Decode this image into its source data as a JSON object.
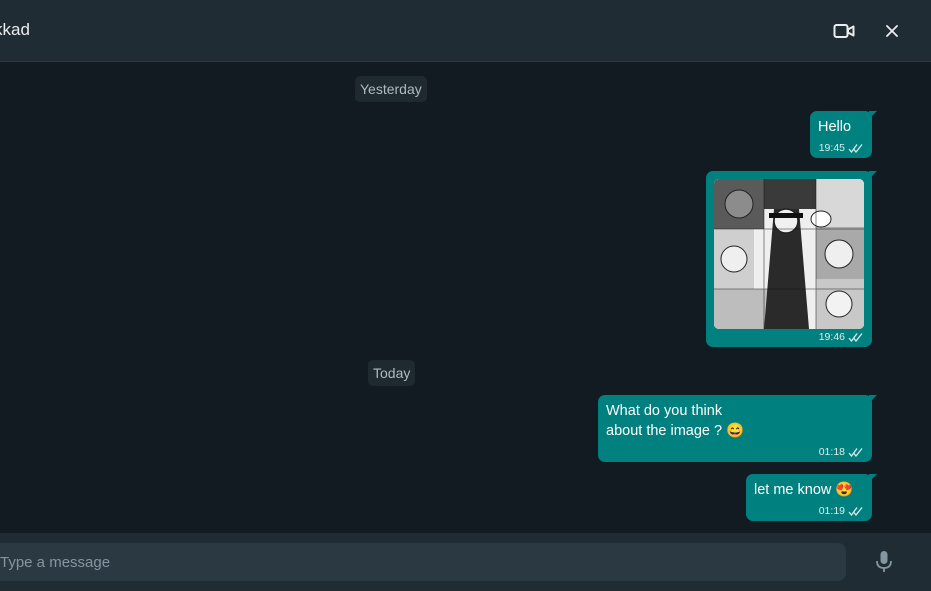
{
  "header": {
    "title": "kkad"
  },
  "chat": {
    "date_separators": [
      "Yesterday",
      "Today"
    ],
    "messages": [
      {
        "text": "Hello",
        "time": "19:45"
      },
      {
        "text": "",
        "time": "19:46",
        "media": "manga-collage-image"
      },
      {
        "text": "What do you think\nabout the image ? 😄",
        "time": "01:18"
      },
      {
        "text": "let me know 😍",
        "time": "01:19"
      }
    ]
  },
  "footer": {
    "input_placeholder": "Type a message"
  },
  "colors": {
    "background": "#121b22",
    "header": "#202c33",
    "bubble_outgoing": "#00807f",
    "chip": "#1e2a30",
    "input": "#2a3942"
  }
}
